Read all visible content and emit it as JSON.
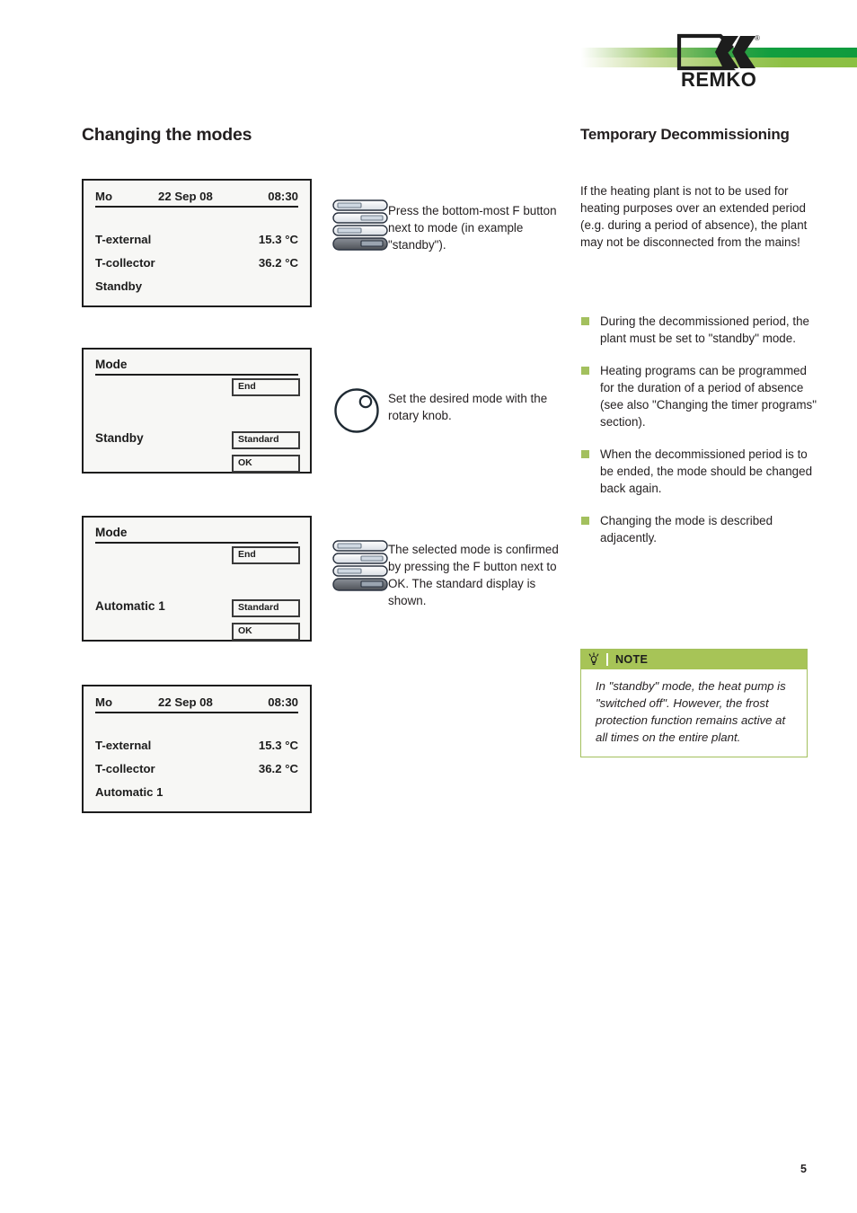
{
  "header": {
    "logo_text": "REMKO",
    "logo_registered": "®",
    "bar_dark_color": "#0f9b3e",
    "bar_light_color": "#8bc043"
  },
  "left_column": {
    "title": "Changing the modes",
    "panels": [
      {
        "type": "status",
        "day": "Mo",
        "date": "22 Sep 08",
        "time": "08:30",
        "rows": [
          {
            "label": "T-external",
            "value": "15.3 °C"
          },
          {
            "label": "T-collector",
            "value": "36.2 °C"
          }
        ],
        "mode": "Standby"
      },
      {
        "type": "mode",
        "title": "Mode",
        "value": "Standby",
        "softkeys": {
          "end": "End",
          "standard": "Standard",
          "ok": "OK"
        }
      },
      {
        "type": "mode",
        "title": "Mode",
        "value": "Automatic 1",
        "softkeys": {
          "end": "End",
          "standard": "Standard",
          "ok": "OK"
        }
      },
      {
        "type": "status",
        "day": "Mo",
        "date": "22 Sep 08",
        "time": "08:30",
        "rows": [
          {
            "label": "T-external",
            "value": "15.3 °C"
          },
          {
            "label": "T-collector",
            "value": "36.2 °C"
          }
        ],
        "mode": "Automatic 1"
      }
    ]
  },
  "middle_column": {
    "steps": [
      {
        "icon": "f-button-stack-icon",
        "text": "Press the bottom-most F button next to mode (in example \"standby\")."
      },
      {
        "icon": "rotary-knob-icon",
        "text": "Set the desired mode with the rotary knob."
      },
      {
        "icon": "f-button-stack-icon",
        "text": "The selected mode is confirmed by pressing the F button next to OK. The standard display is shown."
      }
    ]
  },
  "right_column": {
    "title": "Temporary Decommissioning",
    "intro": "If the heating plant is not to be used for heating purposes over an extended period (e.g. during a period of absence), the plant may not be disconnected from the mains!",
    "bullets": [
      "During the decommissioned period, the plant must be set to \"standby\" mode.",
      "Heating programs can be programmed for the duration of a period of absence (see also \"Changing the timer programs\" section).",
      "When the decommissioned period is to be ended, the mode should be changed back again.",
      "Changing the mode is described adjacently."
    ],
    "bullet_color": "#a3c05e",
    "note": {
      "icon": "lightbulb-icon",
      "title": "NOTE",
      "header_color": "#a7c457",
      "body": "In \"standby\" mode, the heat pump is \"switched off\". However, the frost protection function remains active at all times on the entire plant."
    }
  },
  "footer": {
    "page_number": "5"
  }
}
